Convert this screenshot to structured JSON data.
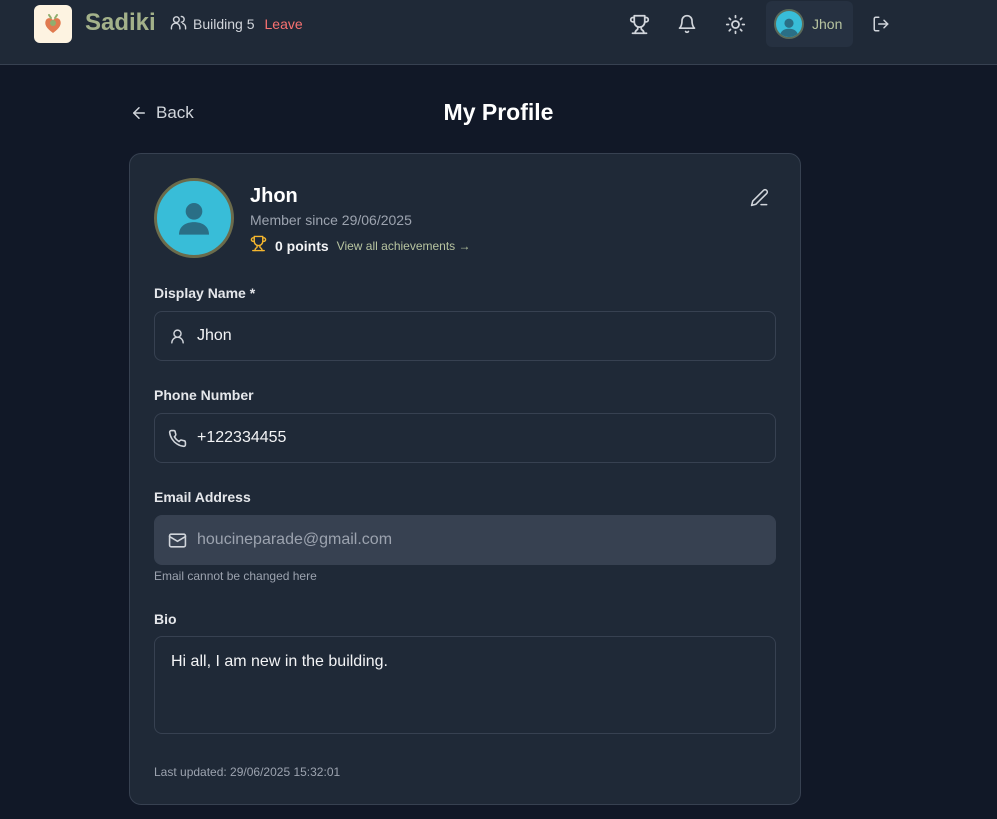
{
  "header": {
    "brand": "Sadiki",
    "building": "Building 5",
    "leave_label": "Leave",
    "user_name": "Jhon",
    "icons": [
      "trophy-icon",
      "bell-icon",
      "sun-icon",
      "logout-icon"
    ]
  },
  "page": {
    "back_label": "Back",
    "title": "My Profile"
  },
  "profile": {
    "name": "Jhon",
    "member_since": "Member since 29/06/2025",
    "points": "0 points",
    "achievements_link": "View all achievements →"
  },
  "form": {
    "display_name_label": "Display Name *",
    "display_name_value": "Jhon",
    "phone_label": "Phone Number",
    "phone_value": "+122334455",
    "email_label": "Email Address",
    "email_value": "houcineparade@gmail.com",
    "email_hint": "Email cannot be changed here",
    "bio_label": "Bio",
    "bio_value": "Hi all, I am new in the building.",
    "last_updated": "Last updated: 29/06/2025 15:32:01"
  },
  "colors": {
    "background": "#111827",
    "card": "#1f2937",
    "brand": "#a3b18a",
    "leave": "#f87171",
    "avatar": "#38bdd8",
    "trophy": "#f5b62e"
  }
}
